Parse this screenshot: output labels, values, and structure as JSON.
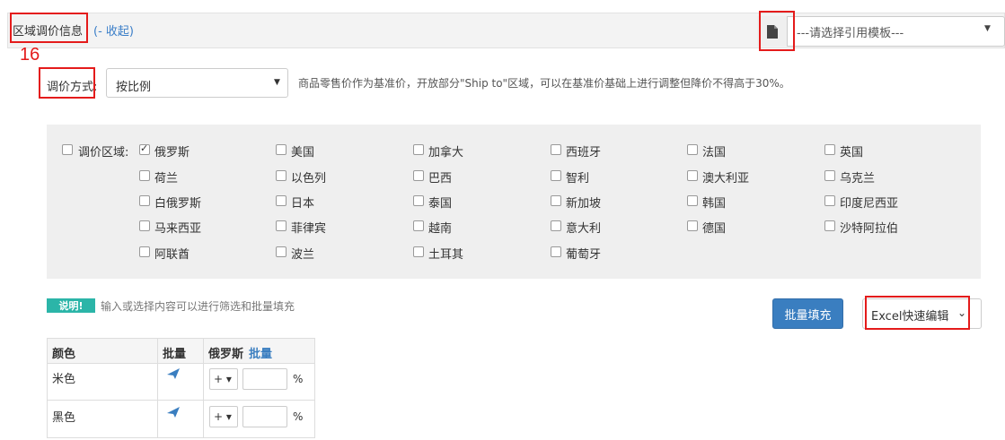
{
  "header": {
    "title": "区域调价信息",
    "collapse_link": "(- 收起)",
    "template_placeholder": "---请选择引用模板---",
    "template_icon": "document-icon"
  },
  "annotation": {
    "number": "16",
    "color": "#e41b1b"
  },
  "adjust": {
    "label": "调价方式:",
    "method": "按比例",
    "description": "商品零售价作为基准价，开放部分\"Ship to\"区域，可以在基准价基础上进行调整但降价不得高于30%。"
  },
  "regions": {
    "label": "调价区域:",
    "items": [
      {
        "name": "俄罗斯",
        "checked": true
      },
      {
        "name": "美国",
        "checked": false
      },
      {
        "name": "加拿大",
        "checked": false
      },
      {
        "name": "西班牙",
        "checked": false
      },
      {
        "name": "法国",
        "checked": false
      },
      {
        "name": "英国",
        "checked": false
      },
      {
        "name": "荷兰",
        "checked": false
      },
      {
        "name": "以色列",
        "checked": false
      },
      {
        "name": "巴西",
        "checked": false
      },
      {
        "name": "智利",
        "checked": false
      },
      {
        "name": "澳大利亚",
        "checked": false
      },
      {
        "name": "乌克兰",
        "checked": false
      },
      {
        "name": "白俄罗斯",
        "checked": false
      },
      {
        "name": "日本",
        "checked": false
      },
      {
        "name": "泰国",
        "checked": false
      },
      {
        "name": "新加坡",
        "checked": false
      },
      {
        "name": "韩国",
        "checked": false
      },
      {
        "name": "印度尼西亚",
        "checked": false
      },
      {
        "name": "马来西亚",
        "checked": false
      },
      {
        "name": "菲律宾",
        "checked": false
      },
      {
        "name": "越南",
        "checked": false
      },
      {
        "name": "意大利",
        "checked": false
      },
      {
        "name": "德国",
        "checked": false
      },
      {
        "name": "沙特阿拉伯",
        "checked": false
      },
      {
        "name": "阿联酋",
        "checked": false
      },
      {
        "name": "波兰",
        "checked": false
      },
      {
        "name": "土耳其",
        "checked": false
      },
      {
        "name": "葡萄牙",
        "checked": false
      }
    ]
  },
  "note": {
    "badge": "说明!",
    "text": "输入或选择内容可以进行筛选和批量填充"
  },
  "buttons": {
    "batch_fill": "批量填充",
    "excel_edit": "Excel快速编辑"
  },
  "table": {
    "headers": {
      "color": "颜色",
      "batch": "批量",
      "region": "俄罗斯",
      "region_batch": "批量"
    },
    "rows": [
      {
        "color": "米色",
        "sign": "+",
        "value": "",
        "unit": "%"
      },
      {
        "color": "黑色",
        "sign": "+",
        "value": "",
        "unit": "%"
      }
    ]
  },
  "colors": {
    "accent": "#3a7ec0",
    "badge": "#2bb5a8",
    "highlight": "#e41b1b"
  }
}
